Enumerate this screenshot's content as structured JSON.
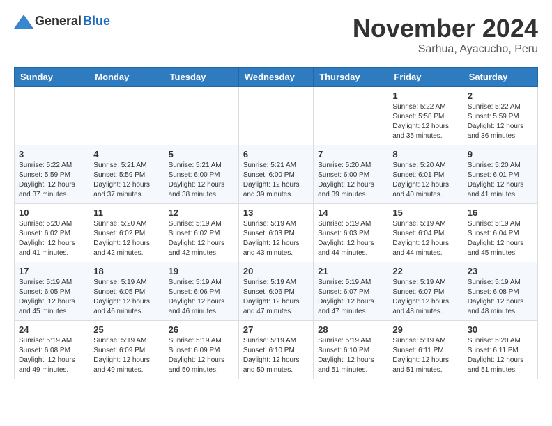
{
  "header": {
    "logo_general": "General",
    "logo_blue": "Blue",
    "month_title": "November 2024",
    "subtitle": "Sarhua, Ayacucho, Peru"
  },
  "weekdays": [
    "Sunday",
    "Monday",
    "Tuesday",
    "Wednesday",
    "Thursday",
    "Friday",
    "Saturday"
  ],
  "weeks": [
    [
      {
        "day": "",
        "info": ""
      },
      {
        "day": "",
        "info": ""
      },
      {
        "day": "",
        "info": ""
      },
      {
        "day": "",
        "info": ""
      },
      {
        "day": "",
        "info": ""
      },
      {
        "day": "1",
        "info": "Sunrise: 5:22 AM\nSunset: 5:58 PM\nDaylight: 12 hours and 35 minutes."
      },
      {
        "day": "2",
        "info": "Sunrise: 5:22 AM\nSunset: 5:59 PM\nDaylight: 12 hours and 36 minutes."
      }
    ],
    [
      {
        "day": "3",
        "info": "Sunrise: 5:22 AM\nSunset: 5:59 PM\nDaylight: 12 hours and 37 minutes."
      },
      {
        "day": "4",
        "info": "Sunrise: 5:21 AM\nSunset: 5:59 PM\nDaylight: 12 hours and 37 minutes."
      },
      {
        "day": "5",
        "info": "Sunrise: 5:21 AM\nSunset: 6:00 PM\nDaylight: 12 hours and 38 minutes."
      },
      {
        "day": "6",
        "info": "Sunrise: 5:21 AM\nSunset: 6:00 PM\nDaylight: 12 hours and 39 minutes."
      },
      {
        "day": "7",
        "info": "Sunrise: 5:20 AM\nSunset: 6:00 PM\nDaylight: 12 hours and 39 minutes."
      },
      {
        "day": "8",
        "info": "Sunrise: 5:20 AM\nSunset: 6:01 PM\nDaylight: 12 hours and 40 minutes."
      },
      {
        "day": "9",
        "info": "Sunrise: 5:20 AM\nSunset: 6:01 PM\nDaylight: 12 hours and 41 minutes."
      }
    ],
    [
      {
        "day": "10",
        "info": "Sunrise: 5:20 AM\nSunset: 6:02 PM\nDaylight: 12 hours and 41 minutes."
      },
      {
        "day": "11",
        "info": "Sunrise: 5:20 AM\nSunset: 6:02 PM\nDaylight: 12 hours and 42 minutes."
      },
      {
        "day": "12",
        "info": "Sunrise: 5:19 AM\nSunset: 6:02 PM\nDaylight: 12 hours and 42 minutes."
      },
      {
        "day": "13",
        "info": "Sunrise: 5:19 AM\nSunset: 6:03 PM\nDaylight: 12 hours and 43 minutes."
      },
      {
        "day": "14",
        "info": "Sunrise: 5:19 AM\nSunset: 6:03 PM\nDaylight: 12 hours and 44 minutes."
      },
      {
        "day": "15",
        "info": "Sunrise: 5:19 AM\nSunset: 6:04 PM\nDaylight: 12 hours and 44 minutes."
      },
      {
        "day": "16",
        "info": "Sunrise: 5:19 AM\nSunset: 6:04 PM\nDaylight: 12 hours and 45 minutes."
      }
    ],
    [
      {
        "day": "17",
        "info": "Sunrise: 5:19 AM\nSunset: 6:05 PM\nDaylight: 12 hours and 45 minutes."
      },
      {
        "day": "18",
        "info": "Sunrise: 5:19 AM\nSunset: 6:05 PM\nDaylight: 12 hours and 46 minutes."
      },
      {
        "day": "19",
        "info": "Sunrise: 5:19 AM\nSunset: 6:06 PM\nDaylight: 12 hours and 46 minutes."
      },
      {
        "day": "20",
        "info": "Sunrise: 5:19 AM\nSunset: 6:06 PM\nDaylight: 12 hours and 47 minutes."
      },
      {
        "day": "21",
        "info": "Sunrise: 5:19 AM\nSunset: 6:07 PM\nDaylight: 12 hours and 47 minutes."
      },
      {
        "day": "22",
        "info": "Sunrise: 5:19 AM\nSunset: 6:07 PM\nDaylight: 12 hours and 48 minutes."
      },
      {
        "day": "23",
        "info": "Sunrise: 5:19 AM\nSunset: 6:08 PM\nDaylight: 12 hours and 48 minutes."
      }
    ],
    [
      {
        "day": "24",
        "info": "Sunrise: 5:19 AM\nSunset: 6:08 PM\nDaylight: 12 hours and 49 minutes."
      },
      {
        "day": "25",
        "info": "Sunrise: 5:19 AM\nSunset: 6:09 PM\nDaylight: 12 hours and 49 minutes."
      },
      {
        "day": "26",
        "info": "Sunrise: 5:19 AM\nSunset: 6:09 PM\nDaylight: 12 hours and 50 minutes."
      },
      {
        "day": "27",
        "info": "Sunrise: 5:19 AM\nSunset: 6:10 PM\nDaylight: 12 hours and 50 minutes."
      },
      {
        "day": "28",
        "info": "Sunrise: 5:19 AM\nSunset: 6:10 PM\nDaylight: 12 hours and 51 minutes."
      },
      {
        "day": "29",
        "info": "Sunrise: 5:19 AM\nSunset: 6:11 PM\nDaylight: 12 hours and 51 minutes."
      },
      {
        "day": "30",
        "info": "Sunrise: 5:20 AM\nSunset: 6:11 PM\nDaylight: 12 hours and 51 minutes."
      }
    ]
  ]
}
